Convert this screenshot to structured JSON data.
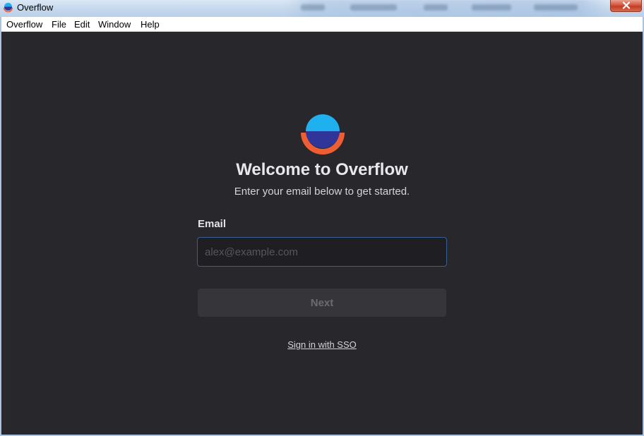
{
  "window": {
    "title": "Overflow"
  },
  "menubar": {
    "items": [
      {
        "label": "Overflow"
      },
      {
        "label": "File"
      },
      {
        "label": "Edit"
      },
      {
        "label": "Window"
      },
      {
        "label": "Help"
      }
    ]
  },
  "welcome": {
    "title": "Welcome to Overflow",
    "subtitle": "Enter your email below to get started."
  },
  "form": {
    "email_label": "Email",
    "email_value": "",
    "email_placeholder": "alex@example.com",
    "next_label": "Next",
    "sso_label": "Sign in with SSO"
  },
  "colors": {
    "logo_top": "#1fb0ef",
    "logo_middle": "#2f3599",
    "logo_ring": "#ef5e32",
    "background": "#28282c",
    "input_border": "#3a5f92"
  },
  "icons": {
    "app": "overflow-logo-icon",
    "close": "close-icon"
  }
}
